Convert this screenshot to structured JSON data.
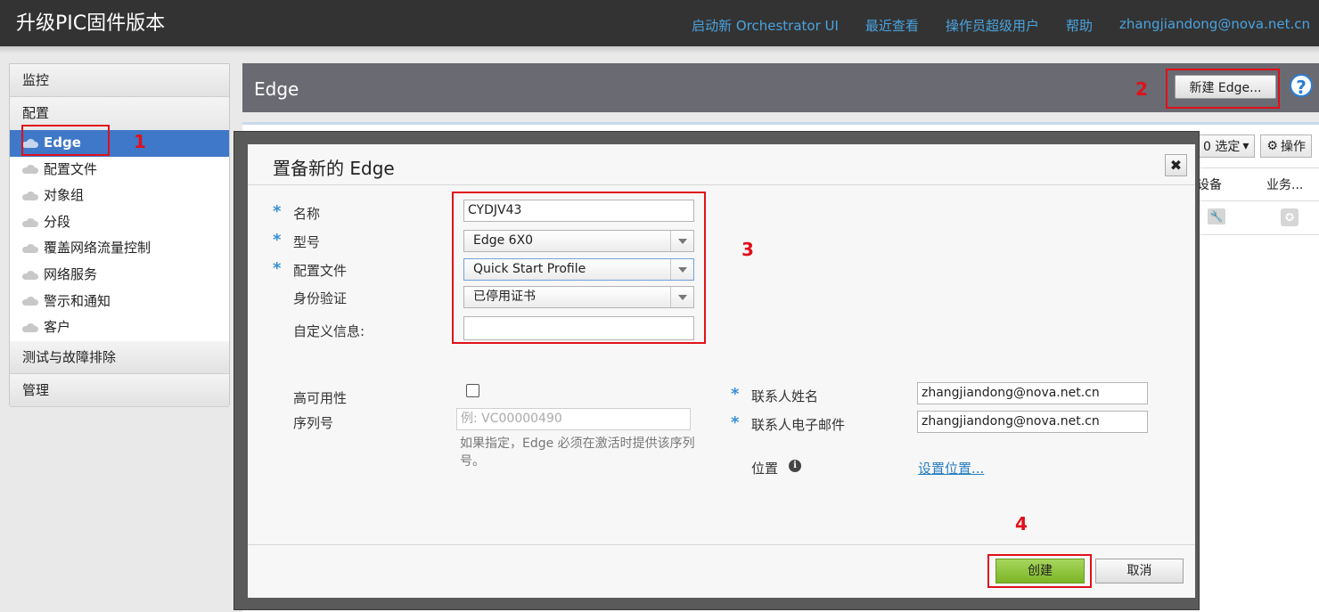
{
  "app_title": "升级PIC固件版本",
  "top_nav": [
    "启动新 Orchestrator UI",
    "最近查看",
    "操作员超级用户",
    "帮助",
    "zhangjiandong@nova.net.cn"
  ],
  "sidebar": {
    "sections": {
      "monitor": "监控",
      "config": "配置",
      "test": "测试与故障排除",
      "manage": "管理"
    },
    "items": [
      "Edge",
      "配置文件",
      "对象组",
      "分段",
      "覆盖网络流量控制",
      "网络服务",
      "警示和通知",
      "客户"
    ],
    "active_item": "Edge"
  },
  "main": {
    "title": "Edge",
    "new_edge_button": "新建 Edge...",
    "help_icon": "?",
    "toolbar": {
      "selected": "0 选定",
      "actions": "操作"
    },
    "columns": [
      "设备",
      "业务..."
    ]
  },
  "dialog": {
    "title": "置备新的 Edge",
    "close_icon": "✖",
    "fields": {
      "name_label": "名称",
      "name_value": "CYDJV43",
      "model_label": "型号",
      "model_value": "Edge 6X0",
      "profile_label": "配置文件",
      "profile_value": "Quick Start Profile",
      "auth_label": "身份验证",
      "auth_value": "已停用证书",
      "custom_info_label": "自定义信息:",
      "custom_info_value": "",
      "ha_label": "高可用性",
      "ha_checked": false,
      "serial_label": "序列号",
      "serial_placeholder": "例: VC00000490",
      "serial_hint": "如果指定，Edge 必须在激活时提供该序列号。",
      "contact_name_label": "联系人姓名",
      "contact_name_value": "zhangjiandong@nova.net.cn",
      "contact_email_label": "联系人电子邮件",
      "contact_email_value": "zhangjiandong@nova.net.cn",
      "location_label": "位置",
      "location_link": "设置位置..."
    },
    "create_button": "创建",
    "cancel_button": "取消"
  },
  "annotations": [
    "1",
    "2",
    "3",
    "4"
  ],
  "colors": {
    "topbar": "#333333",
    "nav_link": "#4aa3df",
    "active_sidebar": "#3f78c8",
    "header": "#6a6a72",
    "required_star": "#3a8fd6",
    "create_button": "#8cc43a",
    "annotation": "#e0101a"
  }
}
